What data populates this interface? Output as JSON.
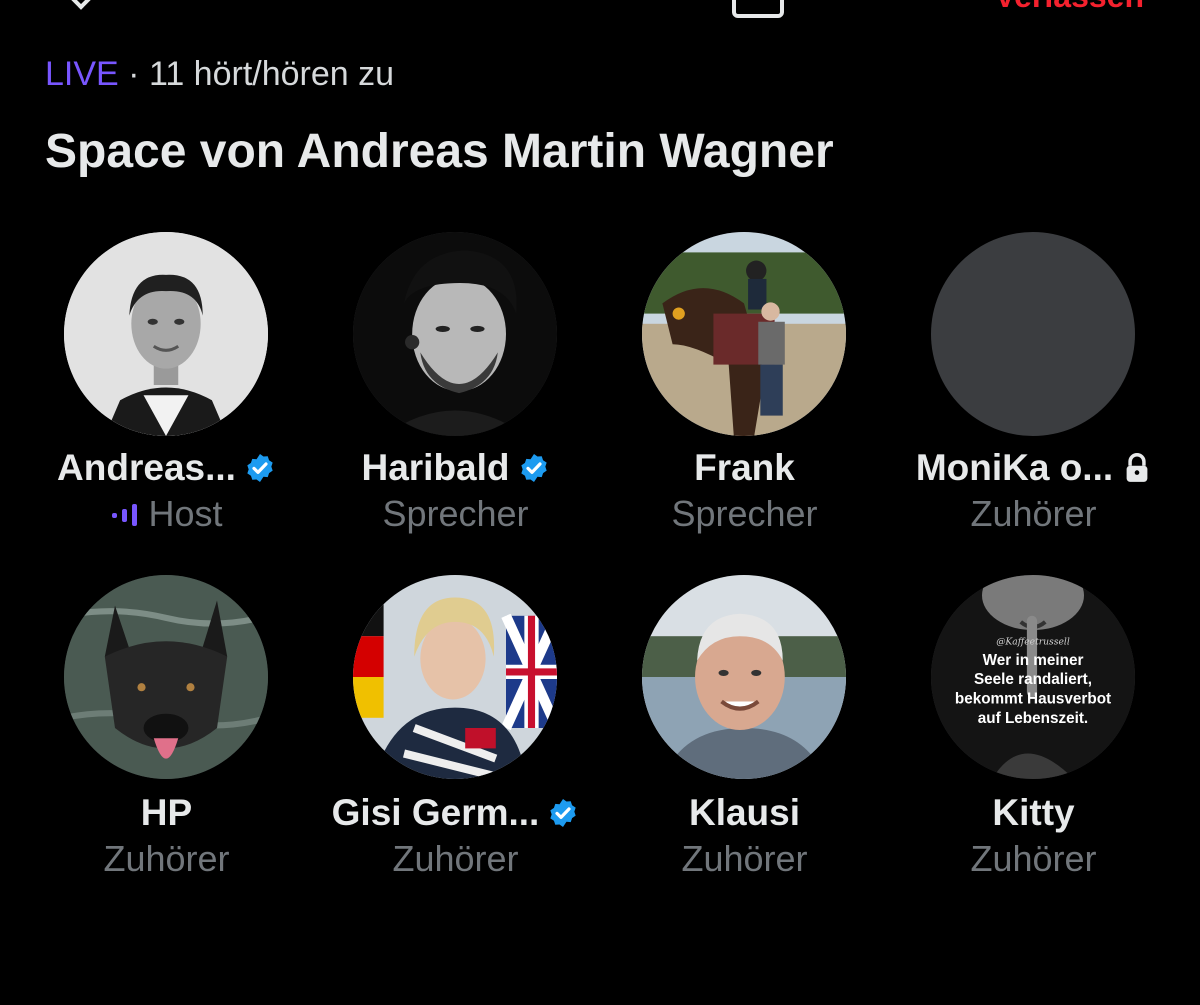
{
  "header": {
    "leave_label": "Verlassen",
    "live_label": "LIVE",
    "separator": " · ",
    "listener_text": "11 hört/hören zu",
    "title": "Space von Andreas Martin Wagner"
  },
  "colors": {
    "live": "#7856ff",
    "verified": "#1d9bf0",
    "leave": "#f4212e",
    "role_text": "#71767b"
  },
  "participants": [
    {
      "name": "Andreas...",
      "role": "Host",
      "verified": true,
      "speaking": true
    },
    {
      "name": "Haribald",
      "role": "Sprecher",
      "verified": true
    },
    {
      "name": "Frank",
      "role": "Sprecher",
      "verified": false
    },
    {
      "name": "MoniKa o...",
      "role": "Zuhörer",
      "locked": true
    },
    {
      "name": "HP",
      "role": "Zuhörer"
    },
    {
      "name": "Gisi Germ...",
      "role": "Zuhörer",
      "verified": true
    },
    {
      "name": "Klausi",
      "role": "Zuhörer"
    },
    {
      "name": "Kitty",
      "role": "Zuhörer",
      "avatar_text": {
        "watermark": "@Kaffeetrussell",
        "lines": [
          "Wer in meiner",
          "Seele randaliert,",
          "bekommt Hausverbot",
          "auf Lebenszeit."
        ]
      }
    }
  ],
  "icons": {
    "verified": "verified-badge-icon",
    "lock": "lock-icon",
    "speaking": "speaking-bars-icon"
  }
}
